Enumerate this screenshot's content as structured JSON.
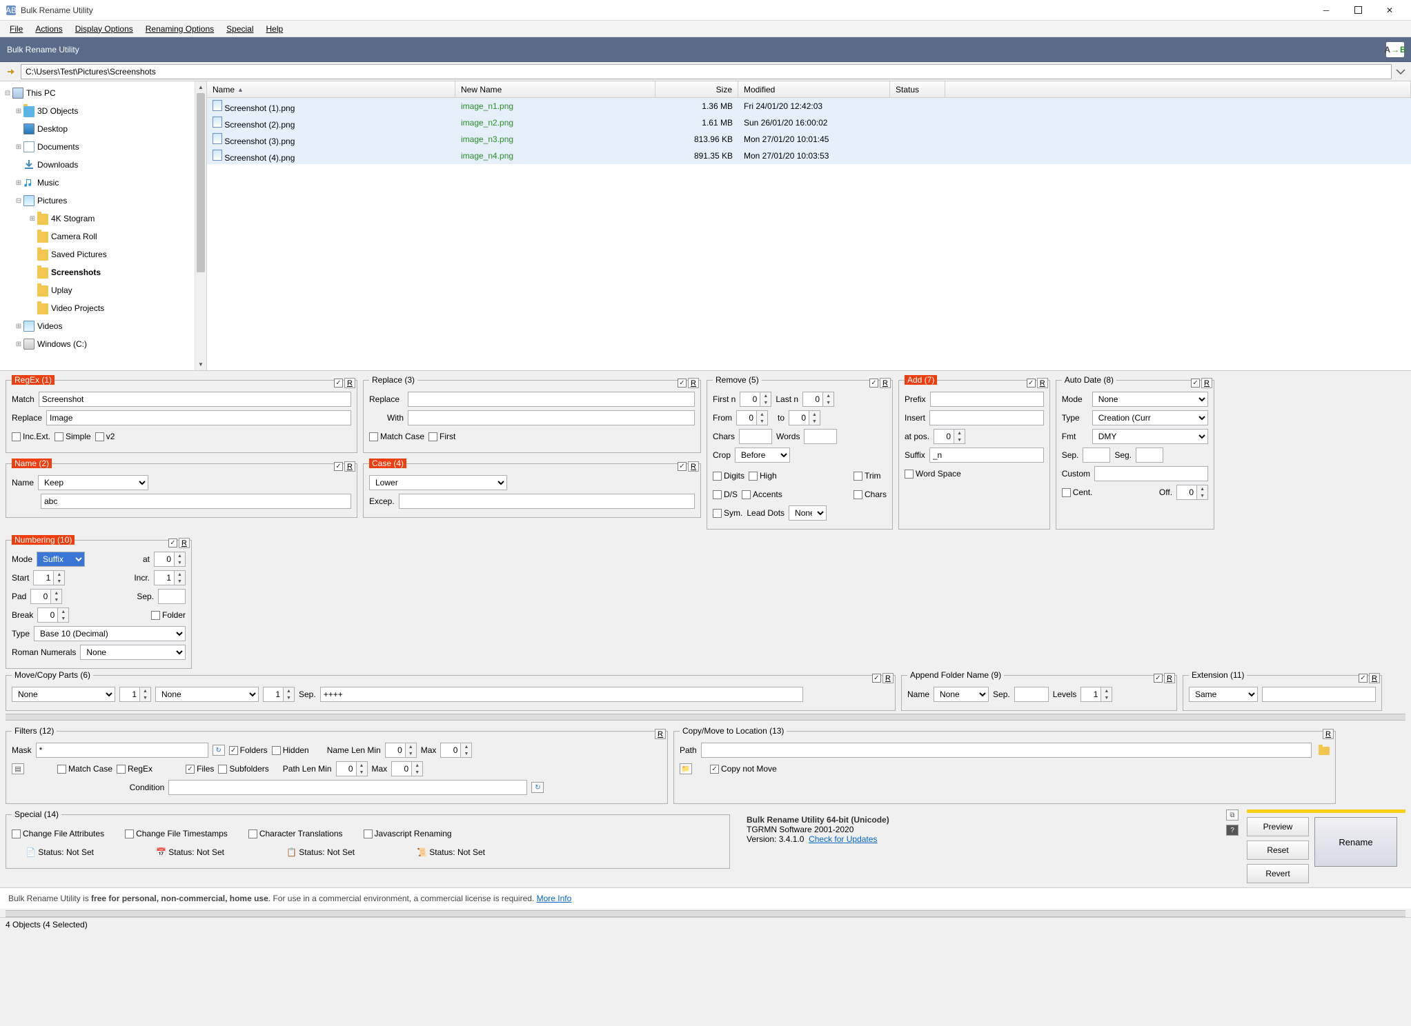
{
  "window": {
    "title": "Bulk Rename Utility"
  },
  "menu": {
    "file": "File",
    "actions": "Actions",
    "display": "Display Options",
    "renaming": "Renaming Options",
    "special": "Special",
    "help": "Help"
  },
  "banner": {
    "title": "Bulk Rename Utility"
  },
  "path": {
    "value": "C:\\Users\\Test\\Pictures\\Screenshots"
  },
  "tree": {
    "root": "This PC",
    "items": [
      "3D Objects",
      "Desktop",
      "Documents",
      "Downloads",
      "Music",
      "Pictures"
    ],
    "pictures_children": [
      "4K Stogram",
      "Camera Roll",
      "Saved Pictures",
      "Screenshots",
      "Uplay",
      "Video Projects"
    ],
    "tail": [
      "Videos",
      "Windows (C:)"
    ]
  },
  "columns": {
    "name": "Name",
    "newname": "New Name",
    "size": "Size",
    "modified": "Modified",
    "status": "Status"
  },
  "rows": [
    {
      "name": "Screenshot (1).png",
      "new": "image_n1.png",
      "size": "1.36 MB",
      "mod": "Fri 24/01/20 12:42:03"
    },
    {
      "name": "Screenshot (2).png",
      "new": "image_n2.png",
      "size": "1.61 MB",
      "mod": "Sun 26/01/20 16:00:02"
    },
    {
      "name": "Screenshot (3).png",
      "new": "image_n3.png",
      "size": "813.96 KB",
      "mod": "Mon 27/01/20 10:01:45"
    },
    {
      "name": "Screenshot (4).png",
      "new": "image_n4.png",
      "size": "891.35 KB",
      "mod": "Mon 27/01/20 10:03:53"
    }
  ],
  "p1": {
    "title": "RegEx (1)",
    "match_label": "Match",
    "match": "Screenshot",
    "replace_label": "Replace",
    "replace": "Image",
    "incext_label": "Inc.Ext.",
    "simple_label": "Simple",
    "v2_label": "v2"
  },
  "p2": {
    "title": "Name (2)",
    "name_label": "Name",
    "value": "Keep",
    "text": "abc"
  },
  "p3": {
    "title": "Replace (3)",
    "replace_label": "Replace",
    "replace": "",
    "with_label": "With",
    "with": "",
    "matchcase": "Match Case",
    "first": "First"
  },
  "p4": {
    "title": "Case (4)",
    "value": "Lower",
    "excep": "Excep.",
    "excep_val": ""
  },
  "p5": {
    "title": "Remove (5)",
    "firstn": "First n",
    "firstn_v": "0",
    "lastn": "Last n",
    "lastn_v": "0",
    "from": "From",
    "from_v": "0",
    "to": "to",
    "to_v": "0",
    "chars": "Chars",
    "words": "Words",
    "crop": "Crop",
    "crop_v": "Before",
    "digits": "Digits",
    "high": "High",
    "ds": "D/S",
    "accents": "Accents",
    "sym": "Sym.",
    "lead": "Lead Dots",
    "lead_v": "None",
    "trim": "Trim",
    "chars2": "Chars"
  },
  "p7": {
    "title": "Add (7)",
    "prefix": "Prefix",
    "insert": "Insert",
    "atpos": "at pos.",
    "atpos_v": "0",
    "suffix": "Suffix",
    "suffix_v": "_n",
    "wordspace": "Word Space"
  },
  "p8": {
    "title": "Auto Date (8)",
    "mode": "Mode",
    "mode_v": "None",
    "type": "Type",
    "type_v": "Creation (Curr",
    "fmt": "Fmt",
    "fmt_v": "DMY",
    "sep": "Sep.",
    "seg": "Seg.",
    "custom": "Custom",
    "cent": "Cent.",
    "off": "Off.",
    "off_v": "0"
  },
  "p10": {
    "title": "Numbering (10)",
    "mode": "Mode",
    "mode_v": "Suffix",
    "at": "at",
    "at_v": "0",
    "start": "Start",
    "start_v": "1",
    "incr": "Incr.",
    "incr_v": "1",
    "pad": "Pad",
    "pad_v": "0",
    "sep": "Sep.",
    "break": "Break",
    "break_v": "0",
    "folder": "Folder",
    "type": "Type",
    "type_v": "Base 10 (Decimal)",
    "roman": "Roman Numerals",
    "roman_v": "None"
  },
  "p6": {
    "title": "Move/Copy Parts (6)",
    "none": "None",
    "v1": "1",
    "sep": "Sep.",
    "sep_v": "++++"
  },
  "p9": {
    "title": "Append Folder Name (9)",
    "name": "Name",
    "name_v": "None",
    "sep": "Sep.",
    "levels": "Levels",
    "levels_v": "1"
  },
  "p11": {
    "title": "Extension (11)",
    "same": "Same"
  },
  "p12": {
    "title": "Filters (12)",
    "mask": "Mask",
    "mask_v": "*",
    "folders": "Folders",
    "hidden": "Hidden",
    "files": "Files",
    "subfolders": "Subfolders",
    "matchcase": "Match Case",
    "regex": "RegEx",
    "namelen": "Name Len Min",
    "pathlen": "Path Len Min",
    "min_v": "0",
    "max": "Max",
    "max_v": "0",
    "condition": "Condition"
  },
  "p13": {
    "title": "Copy/Move to Location (13)",
    "path": "Path",
    "copy": "Copy not Move"
  },
  "p14": {
    "title": "Special (14)",
    "cfa": "Change File Attributes",
    "cft": "Change File Timestamps",
    "ct": "Character Translations",
    "jr": "Javascript Renaming",
    "status": "Status:  Not Set"
  },
  "about": {
    "l1": "Bulk Rename Utility 64-bit (Unicode)",
    "l2": "TGRMN Software 2001-2020",
    "l3": "Version: 3.4.1.0",
    "link": "Check for Updates"
  },
  "buttons": {
    "preview": "Preview",
    "reset": "Reset",
    "revert": "Revert",
    "rename": "Rename"
  },
  "footer": {
    "a": "Bulk Rename Utility is ",
    "b": "free for personal, non-commercial, home use",
    "c": ". For use in a commercial environment, a commercial license is required. ",
    "link": "More Info"
  },
  "status": {
    "text": "4 Objects (4 Selected)"
  },
  "R": "R"
}
